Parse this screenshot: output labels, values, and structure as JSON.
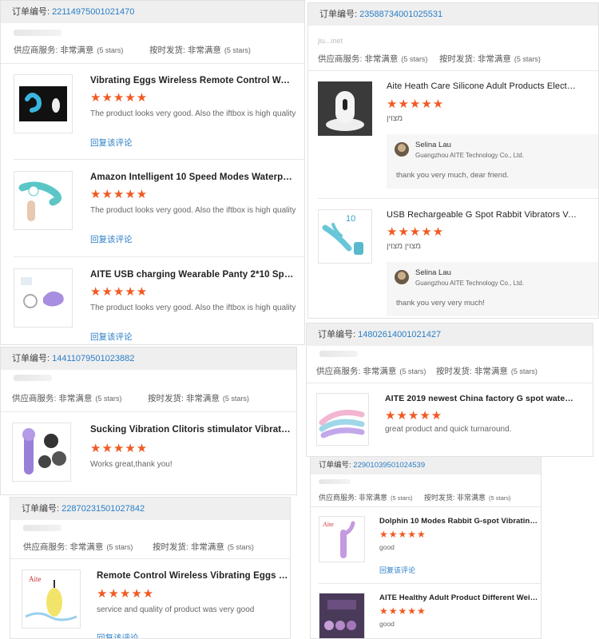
{
  "labels": {
    "order_no": "订单编号:",
    "supplier_service": "供应商服务:",
    "on_time": "按时发货:",
    "very_satisfied": "非常满意",
    "five_stars": "(5 stars)",
    "reply": "回复该评论"
  },
  "stars": "★★★★★",
  "colors": {
    "accent": "#f05a22",
    "link": "#2a7ec6",
    "header_bg": "#efefef"
  },
  "orders": [
    {
      "number": "22114975001021470",
      "items": [
        {
          "title": "Vibrating Eggs Wireless Remote Control Water...",
          "review": "The product looks very good. Also the iftbox is high quality",
          "icon": "purple-egg-vibrator-icon"
        },
        {
          "title": "Amazon Intelligent 10 Speed Modes Waterproo...",
          "review": "The product looks very good. Also the iftbox is high quality",
          "icon": "teal-vibrator-icon"
        },
        {
          "title": "AITE USB charging Wearable Panty 2*10 Speed...",
          "review": "The product looks very good. Also the iftbox is high quality",
          "icon": "purple-wearable-icon"
        }
      ]
    },
    {
      "number": "23588734001025531",
      "seller_blur": "jiu...inet",
      "items": [
        {
          "title": "Aite Heath Care Silicone Adult Products Electri...",
          "review": "מצוין",
          "icon": "white-device-icon",
          "seller_reply": {
            "name": "Selina Lau",
            "company": "Guangzhou AITE Technology Co., Ltd.",
            "message": "thank you very much, dear friend."
          }
        },
        {
          "title": "USB Rechargeable G Spot Rabbit Vibrators Vag...",
          "review": "מצוין מצוין",
          "icon": "blue-rabbit-vibrator-icon",
          "seller_reply": {
            "name": "Selina Lau",
            "company": "Guangzhou AITE Technology Co., Ltd.",
            "message": "thank you very very much!"
          }
        }
      ]
    },
    {
      "number": "14411079501023882",
      "items": [
        {
          "title": "Sucking Vibration Clitoris stimulator Vibrator f...",
          "review": "Works great,thank you!",
          "icon": "purple-stimulator-icon"
        }
      ]
    },
    {
      "number": "14802614001021427",
      "items": [
        {
          "title": "AITE 2019 newest China factory G spot waterp...",
          "review": "great product and quick turnaround.",
          "icon": "pastel-vibrators-icon"
        }
      ]
    },
    {
      "number": "22870231501027842",
      "items": [
        {
          "title": "Remote Control Wireless Vibrating Eggs Sex T...",
          "review": "service and quality of product was very good",
          "icon": "yellow-egg-icon"
        }
      ]
    },
    {
      "number": "22901039501024539",
      "items": [
        {
          "title": "Dolphin 10 Modes Rabbit G-spot Vibrating & R...",
          "review": "good",
          "icon": "purple-rabbit-icon"
        },
        {
          "title": "AITE Healthy Adult Product Different Weighted...",
          "review": "good",
          "icon": "kegel-balls-icon"
        }
      ]
    }
  ]
}
